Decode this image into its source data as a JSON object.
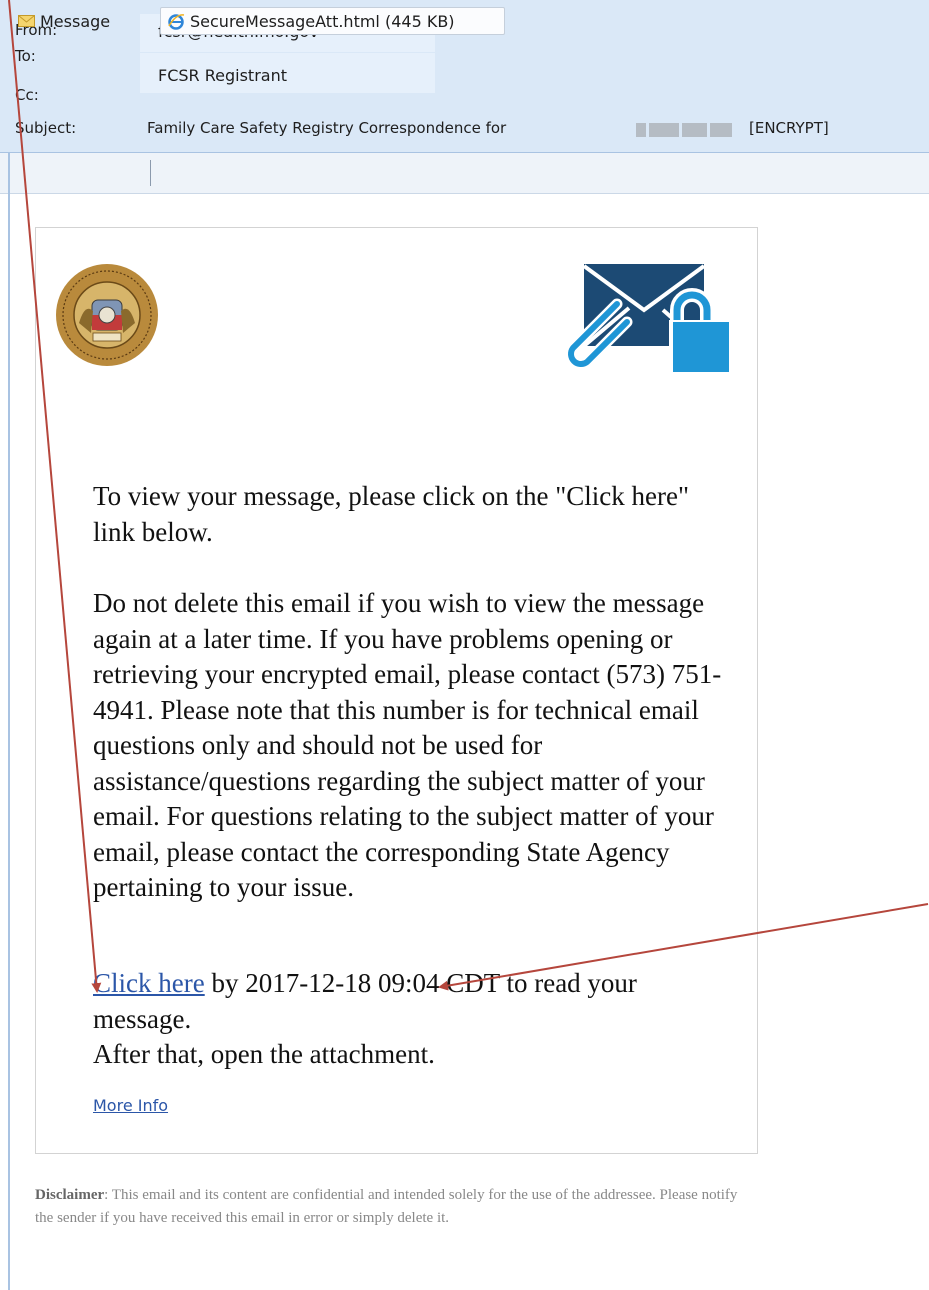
{
  "header": {
    "from_label": "From:",
    "from_value": "fcsr@health.mo.gov",
    "to_label": "To:",
    "to_value": "FCSR Registrant",
    "cc_label": "Cc:",
    "subject_label": "Subject:",
    "subject_value": "Family Care Safety Registry Correspondence for",
    "subject_tag": "[ENCRYPT]"
  },
  "attachments": {
    "message_tab": "Message",
    "attachment_name": "SecureMessageAtt.html (445 KB)",
    "icons": [
      "envelope-icon",
      "ie-icon"
    ]
  },
  "body": {
    "paragraph1": "To view your message, please click on the \"Click here\" link below.",
    "paragraph2": "Do not delete this email if you wish to view the message again at a later time. If you have problems opening or retrieving your encrypted email, please contact (573) 751-4941. Please note that this number is for technical email questions only and should not be used for assistance/questions regarding the subject matter of your email. For questions relating to the subject matter of your email, please contact the corresponding State Agency pertaining to your issue.",
    "click_here": "Click here",
    "deadline_text": " by 2017-12-18 09:04 CDT to read your message.",
    "after_text": "After that, open the attachment.",
    "more_info": "More Info",
    "icons": [
      "missouri-seal-icon",
      "secure-mail-lock-icon"
    ]
  },
  "disclaimer": {
    "label": "Disclaimer",
    "text": ": This email and its content are confidential and intended solely for the use of the addressee. Please notify the sender if you have received this email in error or simply delete it."
  },
  "colors": {
    "header_bg": "#dae8f7",
    "link": "#2b56a8",
    "icon_navy": "#1c4a74",
    "icon_blue": "#1f96d6",
    "arrow": "#b5463c"
  }
}
